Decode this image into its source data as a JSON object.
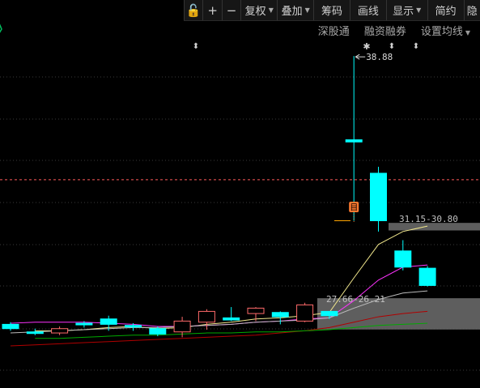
{
  "toolbar": {
    "buttons": [
      {
        "label": "复权",
        "dropdown": true
      },
      {
        "label": "叠加",
        "dropdown": true
      },
      {
        "label": "筹码",
        "dropdown": false
      },
      {
        "label": "画线",
        "dropdown": false
      },
      {
        "label": "显示",
        "dropdown": true
      },
      {
        "label": "简约",
        "dropdown": false
      },
      {
        "label": "隐",
        "dropdown": false
      }
    ],
    "icons": [
      "unlock-icon",
      "zoom-in-icon",
      "zoom-out-icon"
    ],
    "icon_glyphs": [
      "🔓",
      "+",
      "−"
    ]
  },
  "subtabs": {
    "shengutong": "深股通",
    "rongzi": "融资融券",
    "ma_settings": "设置均线"
  },
  "chart_data": {
    "type": "candlestick",
    "colors": {
      "up": "#ff6a6a",
      "down": "#00ffff",
      "ma_yellow": "#f0e68c",
      "ma_magenta": "#ff33ff",
      "ma_white": "#bbbbbb",
      "ma_darkred": "#b00000",
      "ma_green": "#00aa00",
      "ref_line": "#ff5a5a",
      "range_box": "#6e6e6e"
    },
    "y_range": [
      23.5,
      39.6
    ],
    "grid": "dotted-horizontal",
    "candles": [
      {
        "o": 26.45,
        "h": 26.55,
        "l": 26.15,
        "c": 26.25
      },
      {
        "o": 26.1,
        "h": 26.25,
        "l": 25.95,
        "c": 26.05
      },
      {
        "o": 26.05,
        "h": 26.35,
        "l": 25.95,
        "c": 26.25
      },
      {
        "o": 26.5,
        "h": 26.6,
        "l": 26.3,
        "c": 26.45
      },
      {
        "o": 26.7,
        "h": 26.85,
        "l": 26.15,
        "c": 26.45
      },
      {
        "o": 26.4,
        "h": 26.5,
        "l": 26.15,
        "c": 26.35
      },
      {
        "o": 26.25,
        "h": 26.35,
        "l": 25.9,
        "c": 26.0
      },
      {
        "o": 26.1,
        "h": 26.8,
        "l": 25.85,
        "c": 26.6
      },
      {
        "o": 26.55,
        "h": 27.15,
        "l": 26.2,
        "c": 27.05
      },
      {
        "o": 26.75,
        "h": 27.25,
        "l": 26.6,
        "c": 26.65
      },
      {
        "o": 26.95,
        "h": 27.25,
        "l": 26.6,
        "c": 27.2
      },
      {
        "o": 27.0,
        "h": 27.05,
        "l": 26.45,
        "c": 26.8
      },
      {
        "o": 26.6,
        "h": 27.45,
        "l": 26.55,
        "c": 27.35
      },
      {
        "o": 27.05,
        "h": 27.05,
        "l": 26.7,
        "c": 26.85
      },
      {
        "o": 35.0,
        "h": 38.88,
        "l": 31.25,
        "c": 34.9
      },
      {
        "o": 33.45,
        "h": 33.75,
        "l": 30.75,
        "c": 31.25
      },
      {
        "o": 29.85,
        "h": 30.35,
        "l": 28.95,
        "c": 29.1
      },
      {
        "o": 29.05,
        "h": 29.15,
        "l": 28.2,
        "c": 28.25
      }
    ],
    "ma_series": [
      {
        "color_key": "ma_yellow",
        "values": [
          null,
          26.15,
          26.15,
          26.2,
          26.3,
          26.35,
          26.25,
          26.3,
          26.45,
          26.55,
          26.7,
          26.75,
          26.85,
          27.0,
          28.6,
          30.15,
          30.75,
          31.0
        ]
      },
      {
        "color_key": "ma_magenta",
        "values": [
          26.5,
          26.55,
          26.55,
          26.55,
          26.5,
          26.45,
          26.35,
          26.35,
          26.4,
          26.45,
          26.55,
          26.6,
          26.7,
          26.75,
          27.55,
          28.5,
          29.1,
          29.2
        ]
      },
      {
        "color_key": "ma_white",
        "values": [
          26.05,
          26.1,
          26.15,
          26.2,
          26.25,
          26.3,
          26.3,
          26.35,
          26.4,
          26.45,
          26.55,
          26.6,
          26.65,
          26.75,
          27.2,
          27.6,
          27.9,
          28.0
        ]
      },
      {
        "color_key": "ma_darkred",
        "values": [
          25.45,
          25.5,
          25.55,
          25.6,
          25.65,
          25.7,
          25.75,
          25.8,
          25.85,
          25.9,
          25.95,
          26.05,
          26.15,
          26.3,
          26.55,
          26.8,
          26.95,
          27.05
        ]
      },
      {
        "color_key": "ma_green",
        "values": [
          null,
          25.8,
          25.8,
          25.85,
          25.9,
          25.95,
          25.95,
          26.0,
          26.05,
          26.05,
          26.1,
          26.1,
          26.15,
          26.2,
          26.3,
          26.4,
          26.45,
          26.5
        ]
      }
    ],
    "reference_price": 33.15,
    "short_mark_price": 31.25,
    "annotations": {
      "high_label": "38.88",
      "upper_range": "31.15-30.80",
      "lower_range": "27.66-26.21"
    },
    "ranges": [
      {
        "from": 31.15,
        "to": 30.8
      },
      {
        "from": 27.66,
        "to": 26.21
      }
    ],
    "event_marker_text": "目",
    "top_arrow_glyph": "⬍",
    "star_glyph": "✱"
  }
}
